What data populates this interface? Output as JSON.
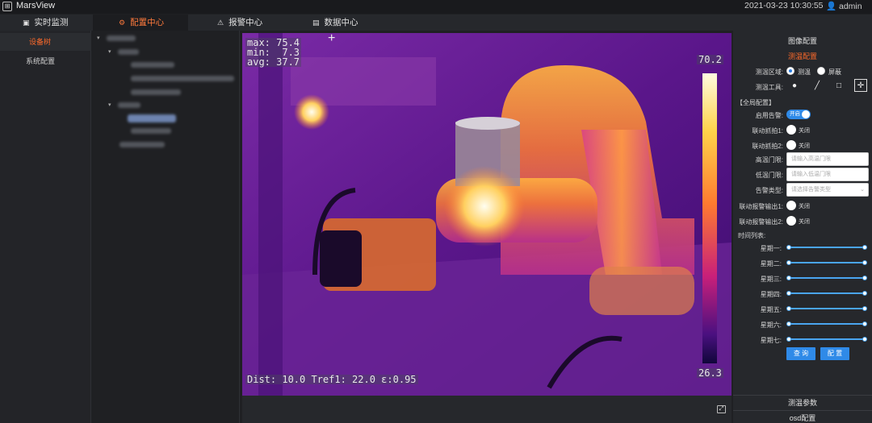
{
  "app": {
    "name": "MarsView",
    "datetime": "2021-03-23 10:30:55",
    "user": "admin"
  },
  "nav": [
    {
      "label": "实时监测",
      "icon": "monitor-icon"
    },
    {
      "label": "配置中心",
      "icon": "gear-icon"
    },
    {
      "label": "报警中心",
      "icon": "alarm-icon"
    },
    {
      "label": "数据中心",
      "icon": "chart-icon"
    }
  ],
  "sidebar": {
    "items": [
      "设备树",
      "系统配置"
    ]
  },
  "overlay": {
    "max": "max: 75.4",
    "min": "min:  7.3",
    "avg": "avg: 37.7",
    "scale_top": "70.2",
    "scale_bottom": "26.3",
    "footer": "Dist: 10.0 Tref1: 22.0 ε:0.95"
  },
  "panel": {
    "header_image": "图像配置",
    "header_temp": "测温配置",
    "region_label": "测温区域:",
    "region_opt1": "测温",
    "region_opt2": "屏蔽",
    "tools_label": "测温工具:",
    "global_label": "【全局配置】",
    "alarm_enable_label": "启用告警:",
    "alarm_enable_state": "开启",
    "link_capture1_label": "联动抓拍1:",
    "link_capture2_label": "联动抓拍2:",
    "off_text": "关闭",
    "high_threshold_label": "高温门限:",
    "high_threshold_placeholder": "请输入高温门限",
    "low_threshold_label": "低温门限:",
    "low_threshold_placeholder": "请输入低温门限",
    "alarm_type_label": "告警类型:",
    "alarm_type_placeholder": "请选择告警类型",
    "link_output1_label": "联动报警输出1:",
    "link_output2_label": "联动报警输出2:",
    "time_list_label": "时间列表:",
    "weekdays": [
      "星期一:",
      "星期二:",
      "星期三:",
      "星期四:",
      "星期五:",
      "星期六:",
      "星期七:"
    ],
    "query_button": "查 询",
    "config_button": "配 置",
    "footer_temp_params": "测温参数",
    "footer_osd": "osd配置"
  },
  "colors": {
    "accent": "#ff6a2a",
    "primary_button": "#2f8ae8"
  }
}
